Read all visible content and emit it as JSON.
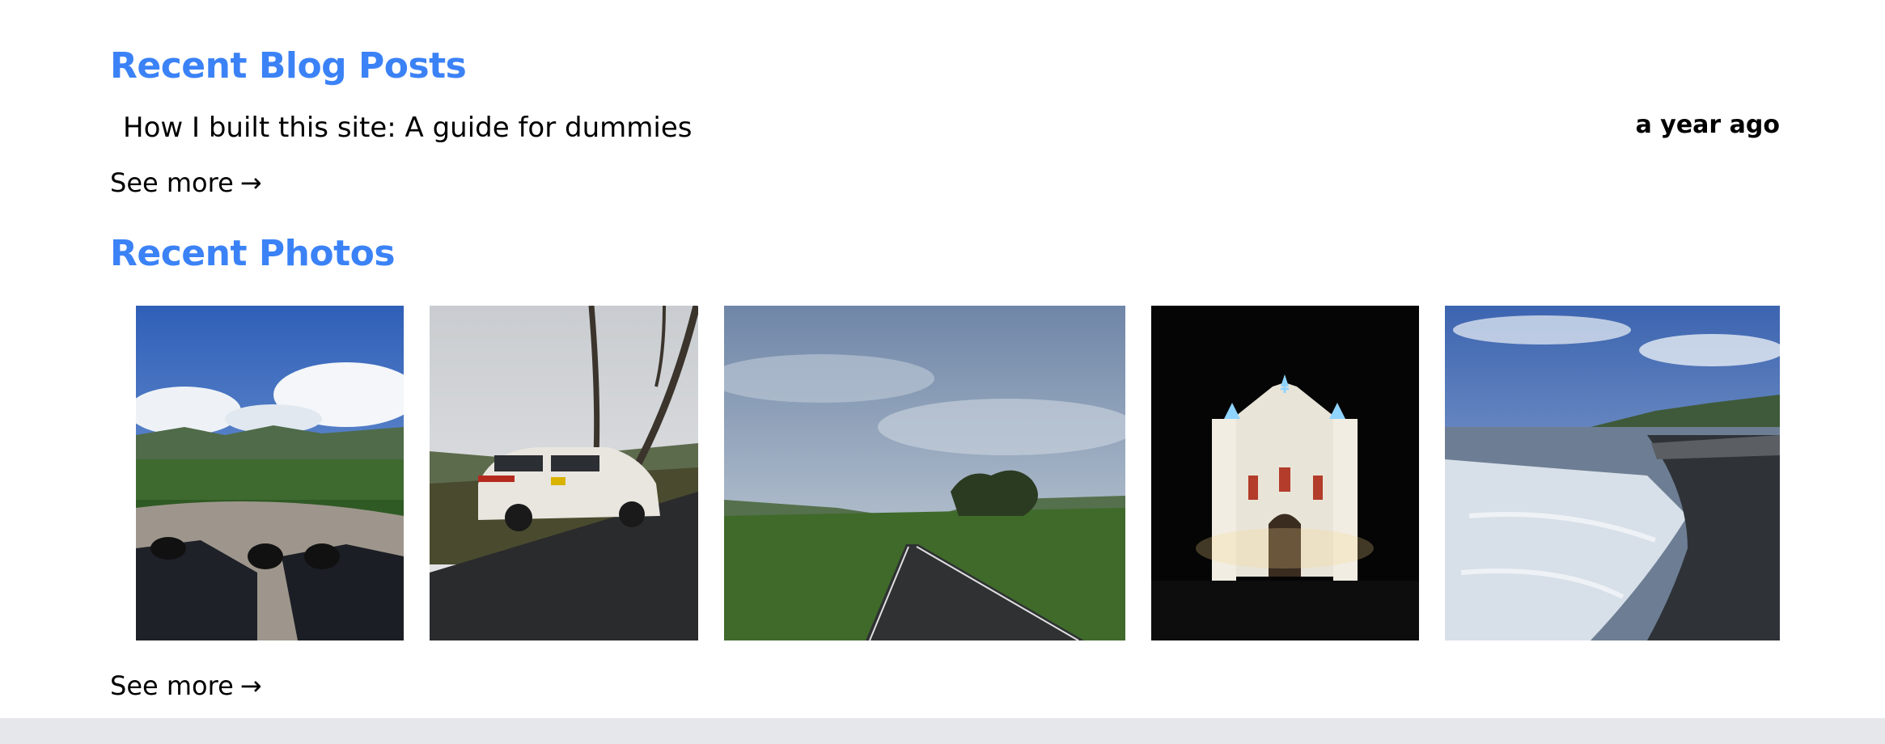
{
  "colors": {
    "accent": "#3b82f6",
    "footer": "#e5e7eb"
  },
  "blog": {
    "heading": "Recent Blog Posts",
    "posts": [
      {
        "title": "How I built this site: A guide for dummies",
        "date": "a year ago"
      }
    ],
    "see_more": "See more",
    "see_more_icon": "arrow-right-icon"
  },
  "photos": {
    "heading": "Recent Photos",
    "items": [
      {
        "subject": "hilltop-view-with-boots-photo"
      },
      {
        "subject": "white-suv-on-road-photo"
      },
      {
        "subject": "empty-road-cloudy-sky-photo"
      },
      {
        "subject": "illuminated-church-night-photo"
      },
      {
        "subject": "coastal-waves-seawall-photo"
      }
    ],
    "see_more": "See more",
    "see_more_icon": "arrow-right-icon"
  }
}
